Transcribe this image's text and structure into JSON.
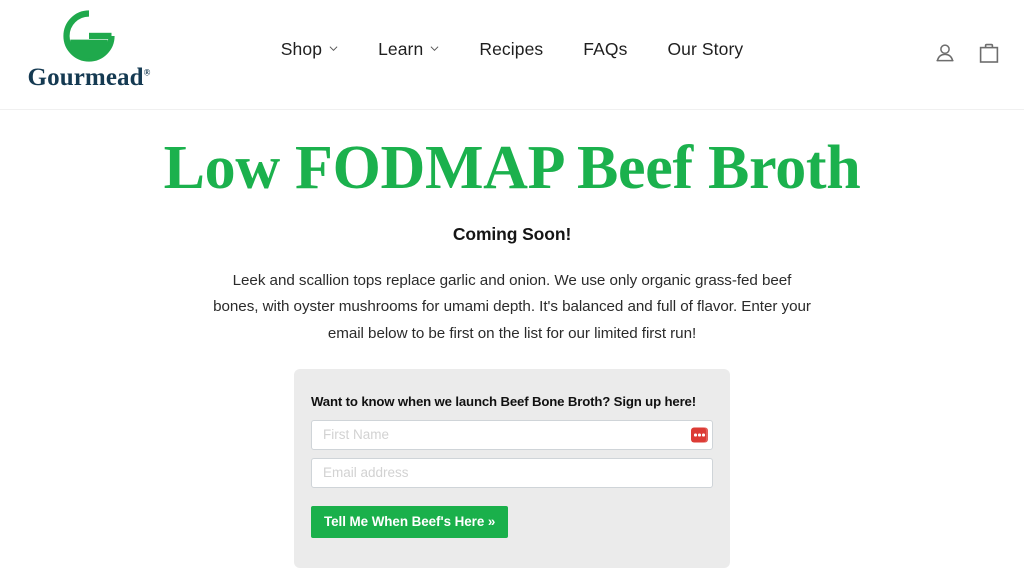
{
  "header": {
    "brand": {
      "name": "Gourmead",
      "registered_mark": "®",
      "logo_icon": "gourmead-mortar-g-logo",
      "brand_color": "#153a52",
      "mark_color": "#1fa94c"
    },
    "nav": [
      {
        "label": "Shop",
        "has_dropdown": true,
        "icon": "chevron-down-icon"
      },
      {
        "label": "Learn",
        "has_dropdown": true,
        "icon": "chevron-down-icon"
      },
      {
        "label": "Recipes",
        "has_dropdown": false
      },
      {
        "label": "FAQs",
        "has_dropdown": false
      },
      {
        "label": "Our Story",
        "has_dropdown": false
      }
    ],
    "actions": [
      {
        "name": "account-icon",
        "label": "Account"
      },
      {
        "name": "cart-icon",
        "label": "Cart"
      }
    ]
  },
  "main": {
    "title": "Low FODMAP Beef Broth",
    "title_color": "#1bb14d",
    "subtitle": "Coming Soon!",
    "body": "Leek and scallion tops replace garlic and onion. We use only organic grass-fed beef bones, with oyster mushrooms for umami depth. It's balanced and full of flavor. Enter your email below to be first on the list for our limited first run!"
  },
  "signup": {
    "heading": "Want to know when we launch Beef Bone Broth? Sign up here!",
    "first_name": {
      "placeholder": "First Name",
      "value": ""
    },
    "email": {
      "placeholder": "Email address",
      "value": ""
    },
    "password_manager_badge": {
      "icon": "password-manager-autofill-icon",
      "color": "#dc3b35"
    },
    "submit_label": "Tell Me When Beef's Here »",
    "submit_color": "#1ab04b",
    "card_background": "#ebebeb"
  }
}
